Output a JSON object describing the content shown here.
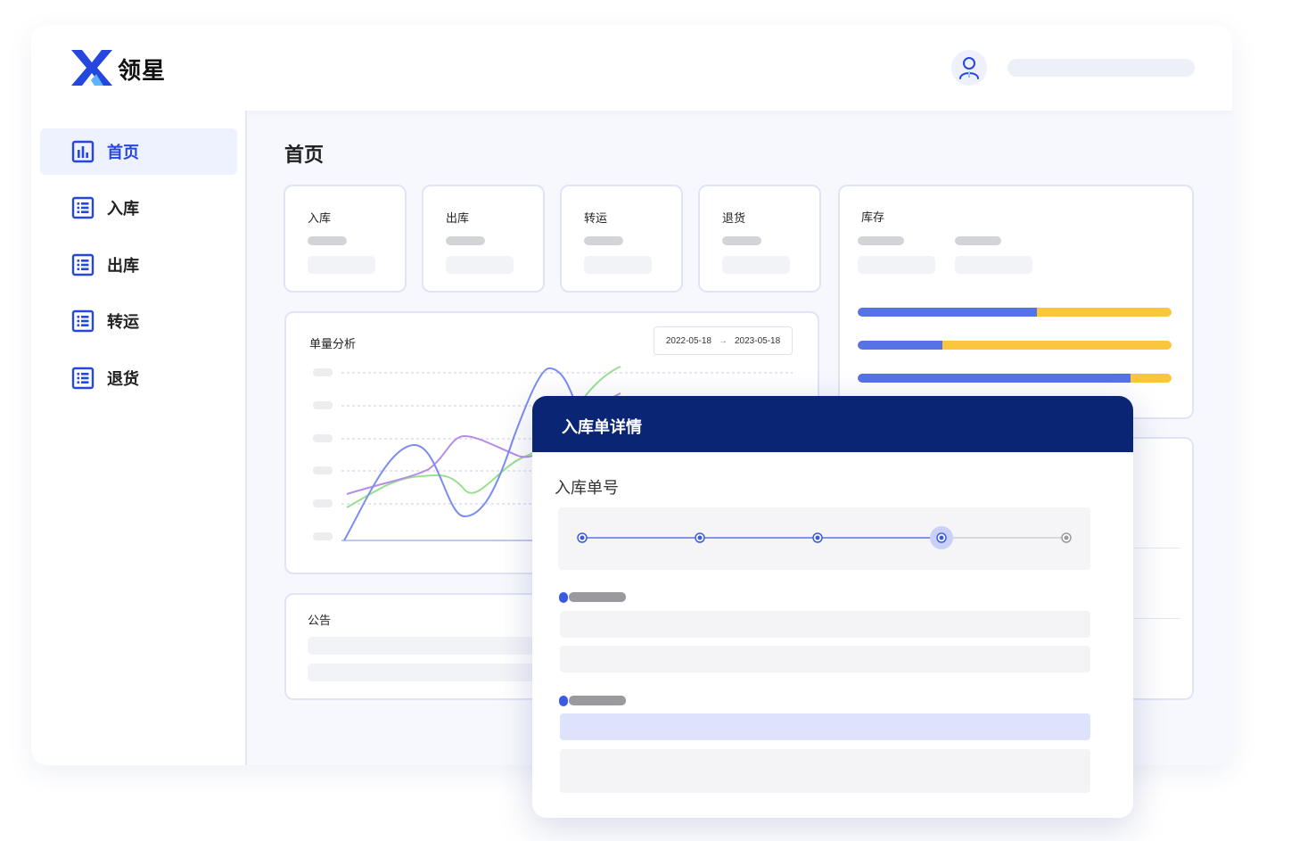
{
  "app": {
    "brand": "领星",
    "logo_icon": "x-logo-icon",
    "user_icon": "user-icon"
  },
  "colors": {
    "accent": "#2547e0",
    "dialog_header": "#092574",
    "bar_blue": "#5673e6",
    "bar_yellow": "#fbc63d"
  },
  "sidebar": {
    "items": [
      {
        "label": "首页",
        "icon": "bar-chart-icon",
        "active": true
      },
      {
        "label": "入库",
        "icon": "list-icon",
        "active": false
      },
      {
        "label": "出库",
        "icon": "list-icon",
        "active": false
      },
      {
        "label": "转运",
        "icon": "list-icon",
        "active": false
      },
      {
        "label": "退货",
        "icon": "list-icon",
        "active": false
      }
    ]
  },
  "main": {
    "title": "首页",
    "stat_cards": [
      {
        "label": "入库"
      },
      {
        "label": "出库"
      },
      {
        "label": "转运"
      },
      {
        "label": "退货"
      }
    ],
    "inventory": {
      "label": "库存",
      "bars": [
        {
          "blue_fraction": 0.57
        },
        {
          "blue_fraction": 0.27
        },
        {
          "blue_fraction": 0.87
        }
      ]
    },
    "analysis": {
      "label": "单量分析",
      "date_start": "2022-05-18",
      "date_end": "2023-05-18",
      "arrow": "→"
    },
    "notice": {
      "label": "公告"
    }
  },
  "dialog": {
    "title": "入库单详情",
    "field_label": "入库单号",
    "steps": {
      "total": 5,
      "current": 4
    }
  }
}
